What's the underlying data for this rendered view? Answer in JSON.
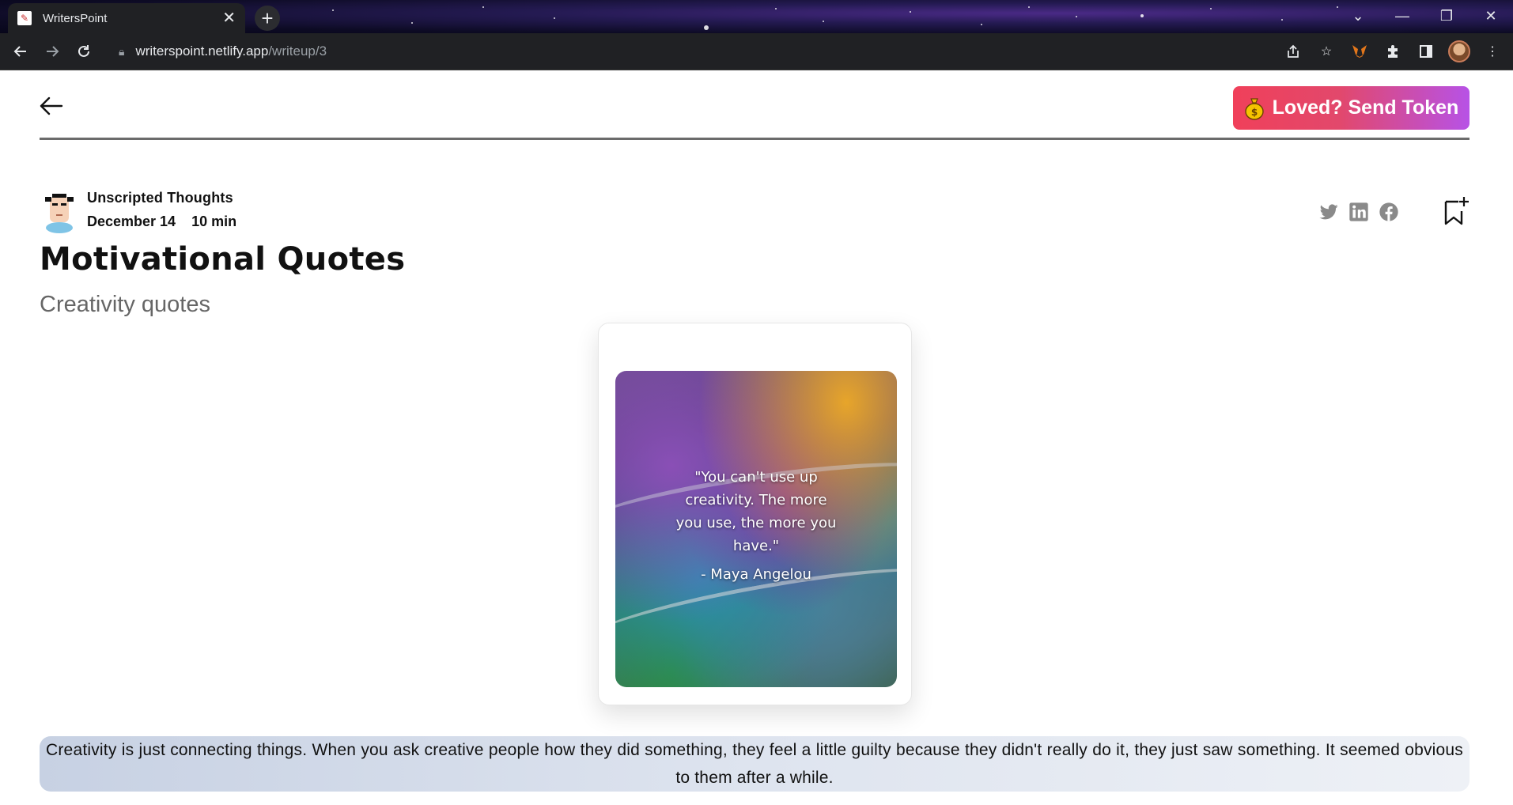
{
  "browser": {
    "tab_title": "WritersPoint",
    "url_host": "writerspoint.netlify.app",
    "url_path": "/writeup/3"
  },
  "header": {
    "token_button_label": "Loved? Send Token"
  },
  "post": {
    "author": "Unscripted Thoughts",
    "date": "December 14",
    "read_time": "10 min",
    "title": "Motivational Quotes",
    "subtitle": "Creativity quotes",
    "image_quote": "\"You can't use up creativity. The more you use, the more you have.\"",
    "image_quote_author": "- Maya Angelou",
    "body": "Creativity is just connecting things. When you ask creative people how they did something, they feel a little guilty because they didn't really do it, they just saw something. It seemed obvious to them after a while."
  },
  "icons": {
    "back": "arrow-left-icon",
    "coin": "money-bag-icon",
    "twitter": "twitter-icon",
    "linkedin": "linkedin-icon",
    "facebook": "facebook-icon",
    "bookmark": "bookmark-add-icon"
  },
  "colors": {
    "token_gradient_start": "#f0405a",
    "token_gradient_end": "#b752e6",
    "share_icon": "#8a8a8a",
    "body_highlight": "#d6deeb"
  }
}
